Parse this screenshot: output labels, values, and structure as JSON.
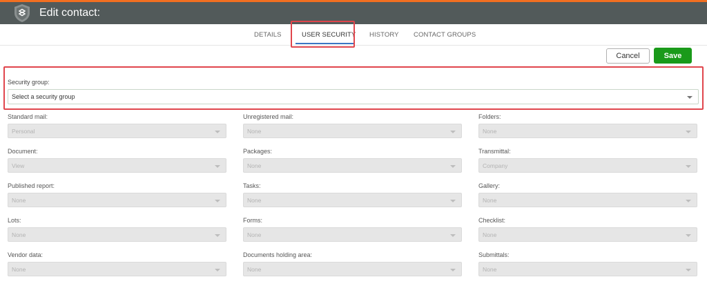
{
  "header": {
    "title": "Edit contact:"
  },
  "tabs": [
    {
      "label": "DETAILS"
    },
    {
      "label": "USER SECURITY"
    },
    {
      "label": "HISTORY"
    },
    {
      "label": "CONTACT GROUPS"
    }
  ],
  "actions": {
    "cancel_label": "Cancel",
    "save_label": "Save"
  },
  "security_group": {
    "label": "Security group:",
    "value": "Select a security group"
  },
  "fields": [
    {
      "label": "Standard mail:",
      "value": "Personal"
    },
    {
      "label": "Unregistered mail:",
      "value": "None"
    },
    {
      "label": "Folders:",
      "value": "None"
    },
    {
      "label": "Document:",
      "value": "View"
    },
    {
      "label": "Packages:",
      "value": "None"
    },
    {
      "label": "Transmittal:",
      "value": "Company"
    },
    {
      "label": "Published report:",
      "value": "None"
    },
    {
      "label": "Tasks:",
      "value": "None"
    },
    {
      "label": "Gallery:",
      "value": "None"
    },
    {
      "label": "Lots:",
      "value": "None"
    },
    {
      "label": "Forms:",
      "value": "None"
    },
    {
      "label": "Checklist:",
      "value": "None"
    },
    {
      "label": "Vendor data:",
      "value": "None"
    },
    {
      "label": "Documents holding area:",
      "value": "None"
    },
    {
      "label": "Submittals:",
      "value": "None"
    }
  ]
}
